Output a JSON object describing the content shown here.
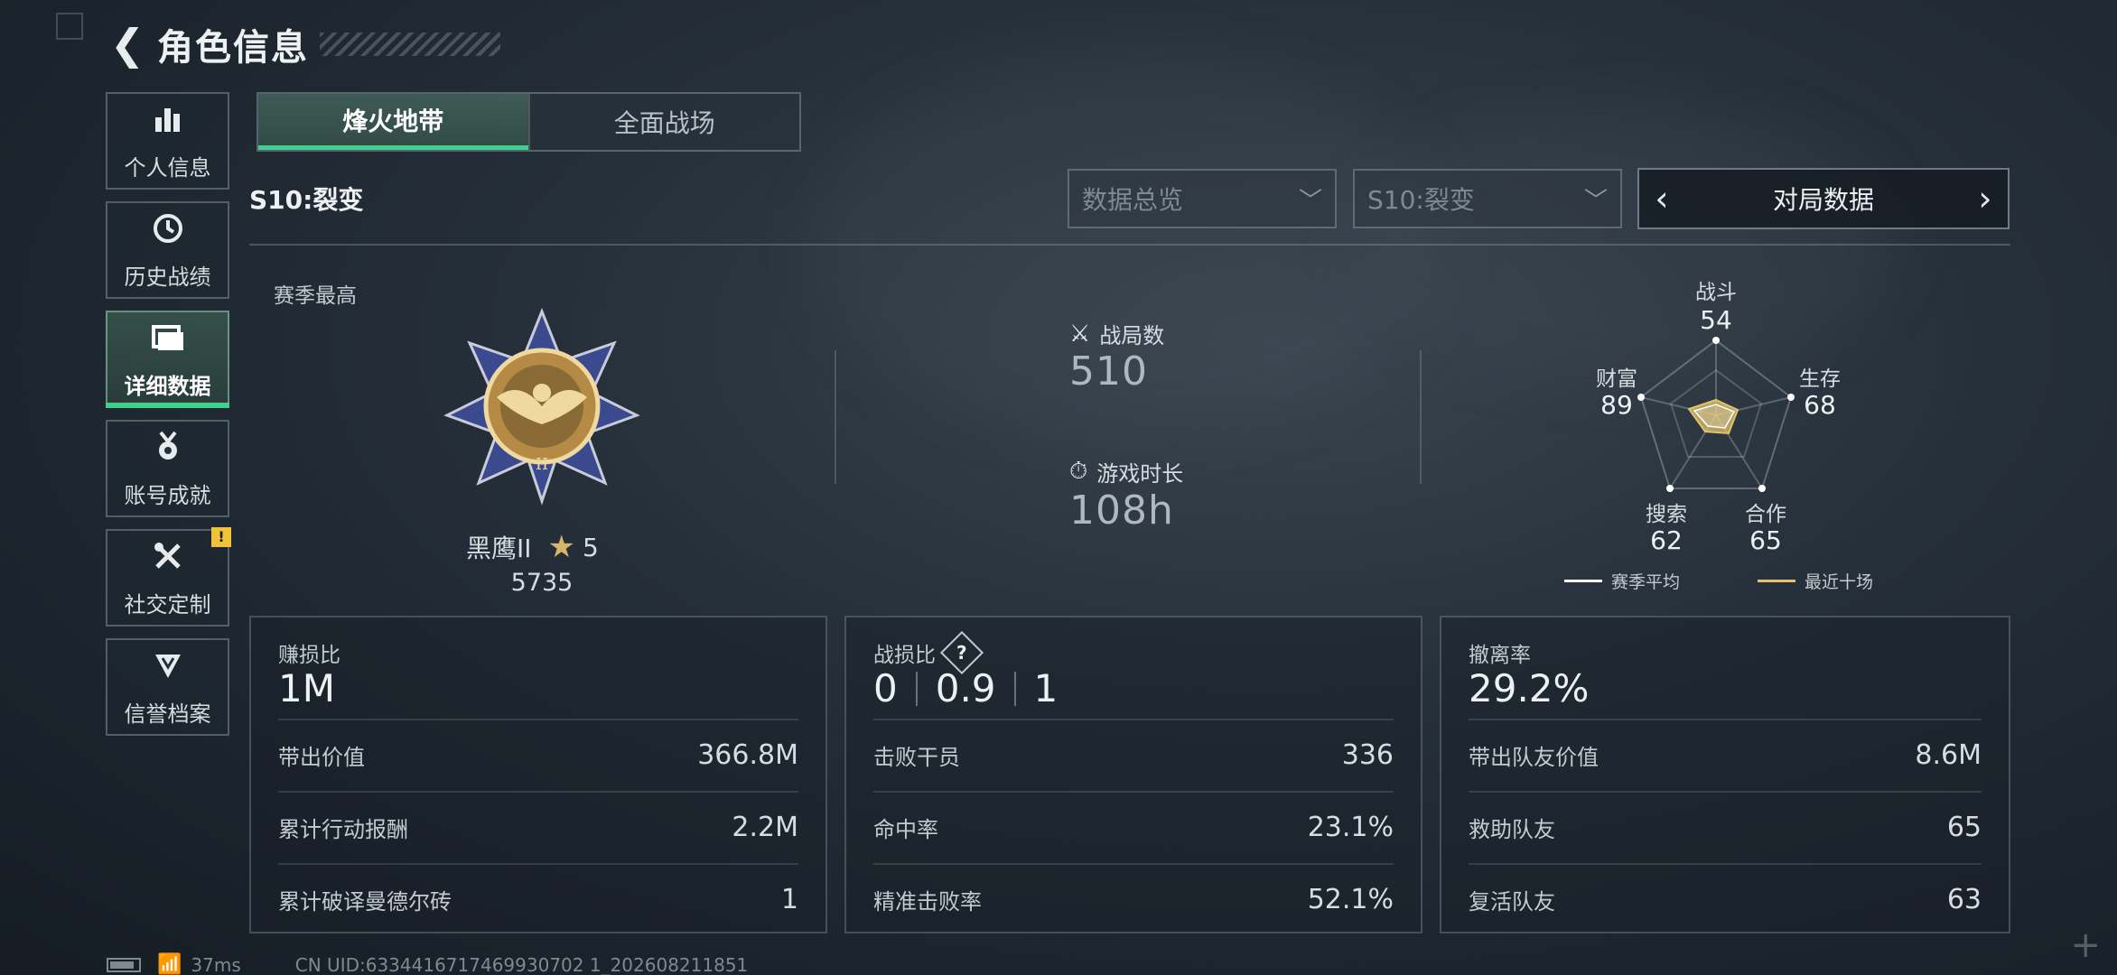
{
  "header": {
    "title": "角色信息"
  },
  "sidebar": {
    "items": [
      {
        "label": "个人信息",
        "icon": "bar-chart-icon"
      },
      {
        "label": "历史战绩",
        "icon": "history-clock-icon"
      },
      {
        "label": "详细数据",
        "icon": "folder-data-icon",
        "active": true
      },
      {
        "label": "账号成就",
        "icon": "medal-icon"
      },
      {
        "label": "社交定制",
        "icon": "tools-icon",
        "badge": "!"
      },
      {
        "label": "信誉档案",
        "icon": "shield-arrow-icon"
      }
    ]
  },
  "tabs": [
    {
      "label": "烽火地带",
      "active": true
    },
    {
      "label": "全面战场",
      "active": false
    }
  ],
  "filters": {
    "season_title": "S10:裂变",
    "dropdown1": "数据总览",
    "dropdown2": "S10:裂变",
    "pager_label": "对局数据"
  },
  "season_best": {
    "label": "赛季最高",
    "rank_name": "黑鹰II",
    "stars": "5",
    "score": "5735"
  },
  "summary": {
    "matches_label": "战局数",
    "matches_value": "510",
    "playtime_label": "游戏时长",
    "playtime_value": "108h"
  },
  "radar": {
    "axes": [
      {
        "name": "战斗",
        "value": "54"
      },
      {
        "name": "生存",
        "value": "68"
      },
      {
        "name": "合作",
        "value": "65"
      },
      {
        "name": "搜索",
        "value": "62"
      },
      {
        "name": "财富",
        "value": "89"
      }
    ],
    "legend_avg": "赛季平均",
    "legend_recent": "最近十场",
    "avg_color": "#ffffff",
    "recent_color": "#e2c36a"
  },
  "cards": [
    {
      "title": "赚损比",
      "main": "1M",
      "rows": [
        {
          "label": "带出价值",
          "value": "366.8M"
        },
        {
          "label": "累计行动报酬",
          "value": "2.2M"
        },
        {
          "label": "累计破译曼德尔砖",
          "value": "1"
        }
      ]
    },
    {
      "title": "战损比",
      "kd": [
        "0",
        "0.9",
        "1"
      ],
      "help": "?",
      "rows": [
        {
          "label": "击败干员",
          "value": "336"
        },
        {
          "label": "命中率",
          "value": "23.1%"
        },
        {
          "label": "精准击败率",
          "value": "52.1%"
        }
      ]
    },
    {
      "title": "撤离率",
      "main": "29.2%",
      "rows": [
        {
          "label": "带出队友价值",
          "value": "8.6M"
        },
        {
          "label": "救助队友",
          "value": "65"
        },
        {
          "label": "复活队友",
          "value": "63"
        }
      ]
    }
  ],
  "footer": {
    "ping": "37ms",
    "uid": "CN UID:6334416717469930702 1_202608211851"
  },
  "colors": {
    "accent": "#3fd08c",
    "badge": "#f0c23a"
  }
}
